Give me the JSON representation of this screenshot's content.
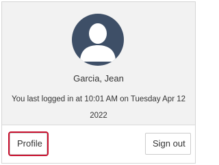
{
  "user": {
    "name": "Garcia, Jean",
    "last_login": "You last logged in at 10:01 AM on Tuesday Apr 12 2022"
  },
  "avatar": {
    "icon": "user-avatar-icon",
    "background_color": "#3e4f67",
    "figure_color": "#ffffff"
  },
  "actions": {
    "profile_label": "Profile",
    "signout_label": "Sign out",
    "highlight_color": "#c8102e"
  }
}
